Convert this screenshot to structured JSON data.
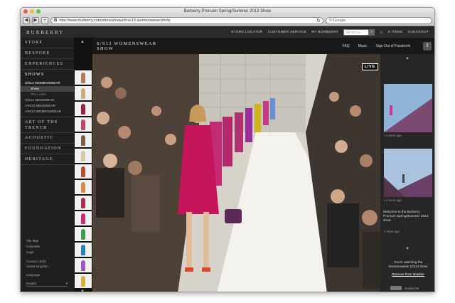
{
  "browser": {
    "title": "Burberry Prorsum Spring/Summer 2013 Show",
    "url": "http://www.burberry.com/store/shows/#/ss13-womenswear/show",
    "search_placeholder": "Google",
    "back": "◀",
    "forward": "▶",
    "add": "+"
  },
  "site": {
    "logo": "BURBERRY",
    "nav": [
      "STORE LOCATOR",
      "CUSTOMER SERVICE",
      "MY BURBERRY"
    ],
    "search_placeholder": "SEARCH",
    "bag": "0 ITEMS",
    "checkout": "CHECKOUT"
  },
  "sidebar": {
    "items": [
      "STORE",
      "BESPOKE",
      "EXPERIENCES"
    ],
    "shows_label": "SHOWS",
    "shows_sub": [
      "S/S13 WOMENSWEAR",
      "Show",
      "The Looks",
      "S/S13 MENSWEAR",
      "A/W12 MENSWEAR",
      "A/W12 WOMENSWEAR"
    ],
    "items2": [
      "ART OF THE TRENCH",
      "ACOUSTIC",
      "FOUNDATION",
      "HERITAGE"
    ],
    "footer": [
      "Site Map",
      "Corporate",
      "Legal",
      "Country | Edit |",
      "United Kingdom",
      "Language",
      "English"
    ]
  },
  "header": {
    "title_line1": "S/S13 WOMENSWEAR",
    "title_line2": "SHOW",
    "links": [
      "FAQ",
      "Music",
      "Sign Out of Facebook"
    ]
  },
  "stage": {
    "live_label": "LIVE"
  },
  "panel": {
    "time1": "2 mins ago",
    "time2": "2 mins ago",
    "welcome": "Welcome to the Burberry Prorsum Spring/Summer 2013 show",
    "time3": "2 mins ago",
    "watching": "You're watching the Womenswear S/S13 show",
    "remove": "Remove from timeline",
    "social": "Social On"
  },
  "colors": {
    "accent": "#c4145a",
    "dark": "#1e1e1e"
  }
}
